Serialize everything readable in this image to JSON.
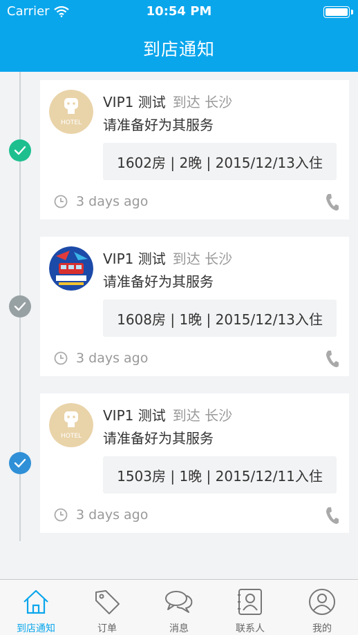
{
  "status_bar": {
    "carrier": "Carrier",
    "time": "10:54 PM"
  },
  "header": {
    "title": "到店通知"
  },
  "notifications": [
    {
      "name": "VIP1 测试",
      "arrival": "到达 长沙",
      "message": "请准备好为其服务",
      "details": "1602房 | 2晚 | 2015/12/13入住",
      "time_ago": "3 days ago",
      "status_color": "#1dbf8f",
      "avatar": "hotel-logo"
    },
    {
      "name": "VIP1 测试",
      "arrival": "到达 长沙",
      "message": "请准备好为其服务",
      "details": "1608房 | 1晚 | 2015/12/13入住",
      "time_ago": "3 days ago",
      "status_color": "#97a0a3",
      "avatar": "photo"
    },
    {
      "name": "VIP1 测试",
      "arrival": "到达 长沙",
      "message": "请准备好为其服务",
      "details": "1503房 | 1晚 | 2015/12/11入住",
      "time_ago": "3 days ago",
      "status_color": "#2f90d7",
      "avatar": "hotel-logo"
    }
  ],
  "tabs": [
    {
      "label": "到店通知",
      "icon": "home-icon",
      "active": true
    },
    {
      "label": "订单",
      "icon": "tag-icon",
      "active": false
    },
    {
      "label": "消息",
      "icon": "chat-icon",
      "active": false
    },
    {
      "label": "联系人",
      "icon": "contacts-icon",
      "active": false
    },
    {
      "label": "我的",
      "icon": "profile-icon",
      "active": false
    }
  ],
  "colors": {
    "accent": "#0aa6ec",
    "background": "#f1f3f5"
  }
}
